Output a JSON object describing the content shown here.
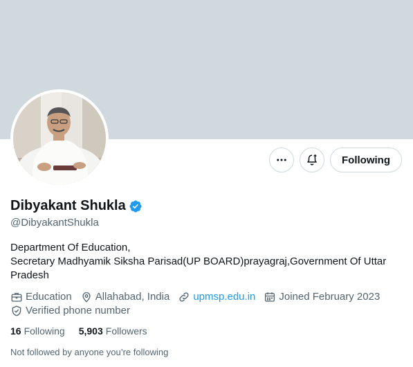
{
  "profile": {
    "display_name": "Dibyakant Shukla",
    "handle": "@DibyakantShukla",
    "verified_icon": "verified-badge-icon",
    "bio_lines": [
      "Department Of Education,",
      "Secretary Madhyamik Siksha Parisad(UP BOARD)prayagraj,Government Of Uttar Pradesh"
    ]
  },
  "actions": {
    "more_icon": "more-icon",
    "notify_icon": "bell-plus-icon",
    "follow_label": "Following"
  },
  "meta": {
    "category": "Education",
    "location": "Allahabad, India",
    "website": "upmsp.edu.in",
    "joined": "Joined February 2023",
    "phone": "Verified phone number"
  },
  "counts": {
    "following_value": "16",
    "following_label": "Following",
    "followers_value": "5,903",
    "followers_label": "Followers"
  },
  "not_followed_text": "Not followed by anyone you’re following",
  "colors": {
    "banner": "#cfd9de",
    "accent": "#1d9bf0",
    "text": "#0f1419",
    "muted": "#536471"
  }
}
